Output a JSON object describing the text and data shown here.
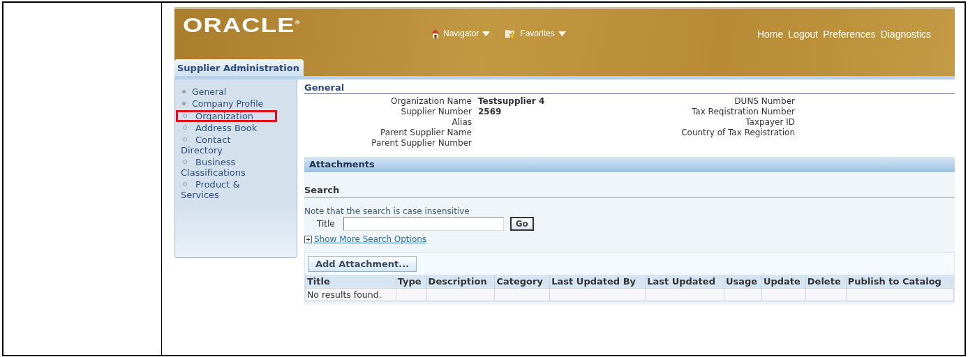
{
  "header": {
    "logo": "ORACLE",
    "logo_mark": "®",
    "menus": [
      {
        "label": "Navigator",
        "kind": "home"
      },
      {
        "label": "Favorites",
        "kind": "favorites"
      }
    ],
    "links": [
      "Home",
      "Logout",
      "Preferences",
      "Diagnostics"
    ]
  },
  "tab": {
    "label": "Supplier Administration",
    "selected": true
  },
  "sidebar": {
    "items": [
      {
        "label": "General",
        "selected": false
      },
      {
        "label": "Company Profile",
        "selected": false,
        "children": [
          {
            "label": "Orqanization",
            "selected": true
          },
          {
            "label": "Address Book",
            "selected": false
          },
          {
            "label": "Contact Directory",
            "selected": false
          },
          {
            "label": "Business Classifications",
            "selected": false
          },
          {
            "label": "Product & Services",
            "selected": false
          }
        ]
      }
    ]
  },
  "general": {
    "title": "General",
    "left": [
      {
        "label": "Organization Name",
        "value": "Testsupplier 4"
      },
      {
        "label": "Supplier Number",
        "value": "2569"
      },
      {
        "label": "Alias"
      },
      {
        "label": "Parent Supplier Name"
      },
      {
        "label": "Parent Supplier Number"
      }
    ],
    "right": [
      {
        "label": "DUNS Number"
      },
      {
        "label": "Tax Reqistration Number"
      },
      {
        "label": "Taxpayer ID"
      },
      {
        "label": "Country of Tax Registration"
      }
    ]
  },
  "attachments": {
    "title": "Attachments",
    "search_title": "Search",
    "note": "Note that the search is case insensitive",
    "field_label": "Title",
    "go": "Go",
    "more_options": "Show More Search Options",
    "add_button": "Add Attachment...",
    "table": {
      "columns": [
        "Title",
        "Type",
        "Description",
        "Category",
        "Last Updated By",
        "Last Updated",
        "Usage",
        "Update",
        "Delete",
        "Publish to Catalog"
      ],
      "empty": "No results found."
    }
  }
}
